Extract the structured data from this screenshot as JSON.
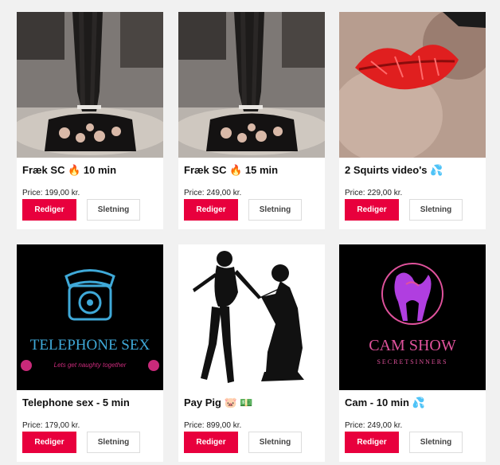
{
  "products": [
    {
      "title": "Fræk SC 🔥 10 min",
      "price": "Price: 199,00 kr.",
      "edit_label": "Rediger",
      "delete_label": "Sletning",
      "thumbnail": "stockings-legs-photo"
    },
    {
      "title": "Fræk SC 🔥 15 min",
      "price": "Price: 249,00 kr.",
      "edit_label": "Rediger",
      "delete_label": "Sletning",
      "thumbnail": "stockings-legs-photo"
    },
    {
      "title": "2 Squirts video's 💦",
      "price": "Price: 229,00 kr.",
      "edit_label": "Rediger",
      "delete_label": "Sletning",
      "thumbnail": "red-lips-photo"
    },
    {
      "title": "Telephone sex - 5 min",
      "price": "Price: 179,00 kr.",
      "edit_label": "Rediger",
      "delete_label": "Sletning",
      "thumbnail": "telephone-sex-graphic",
      "thumbnail_text": {
        "headline": "TELEPHONE SEX",
        "tagline": "Lets get naughty together"
      }
    },
    {
      "title": "Pay Pig 🐷 💵",
      "price": "Price: 899,00 kr.",
      "edit_label": "Rediger",
      "delete_label": "Sletning",
      "thumbnail": "silhouette-leash-graphic"
    },
    {
      "title": "Cam - 10 min 💦",
      "price": "Price: 249,00 kr.",
      "edit_label": "Rediger",
      "delete_label": "Sletning",
      "thumbnail": "cam-show-graphic",
      "thumbnail_text": {
        "headline": "CAM SHOW",
        "tagline": "SECRETSINNERS"
      }
    }
  ],
  "colors": {
    "page_background": "#f1f1f1",
    "card_background": "#ffffff",
    "edit_button": "#e8003d",
    "delete_border": "#dcdcdc",
    "telephone_neon": "#3fa9d8",
    "cam_show_pink": "#e0529c"
  }
}
